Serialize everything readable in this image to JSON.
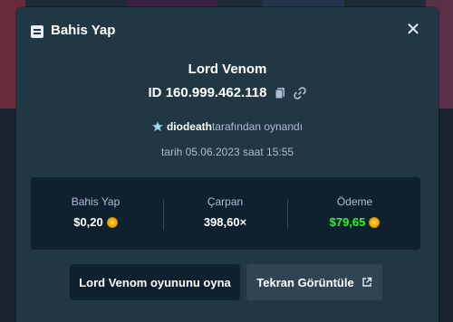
{
  "modal": {
    "title": "Bahis Yap",
    "close_symbol": "✕"
  },
  "bet": {
    "game_name": "Lord Venom",
    "id_label": "ID",
    "id_value": "160.999.462.118",
    "username": "diodeath",
    "played_by_suffix": "tarafından oynandı",
    "date_text": "tarih 05.06.2023 saat 15:55"
  },
  "stats": {
    "bet": {
      "label": "Bahis Yap",
      "value": "$0,20"
    },
    "multiplier": {
      "label": "Çarpan",
      "value": "398,60×"
    },
    "payout": {
      "label": "Ödeme",
      "value": "$79,65"
    }
  },
  "buttons": {
    "play": "Lord Venom oyununu oyna",
    "screenshot": "Tekran Görüntüle"
  },
  "icons": {
    "header": "bet-slip-icon",
    "copy": "copy-icon",
    "link": "link-icon",
    "star": "star-icon",
    "coin": "coin-icon",
    "external": "external-link-icon"
  },
  "colors": {
    "modal_bg": "#213743",
    "stats_bg": "#0f212e",
    "payout_green": "#1fff20",
    "muted_text": "#b1bad3",
    "coin": "#f5b10a",
    "secondary_button": "#2f4553"
  }
}
